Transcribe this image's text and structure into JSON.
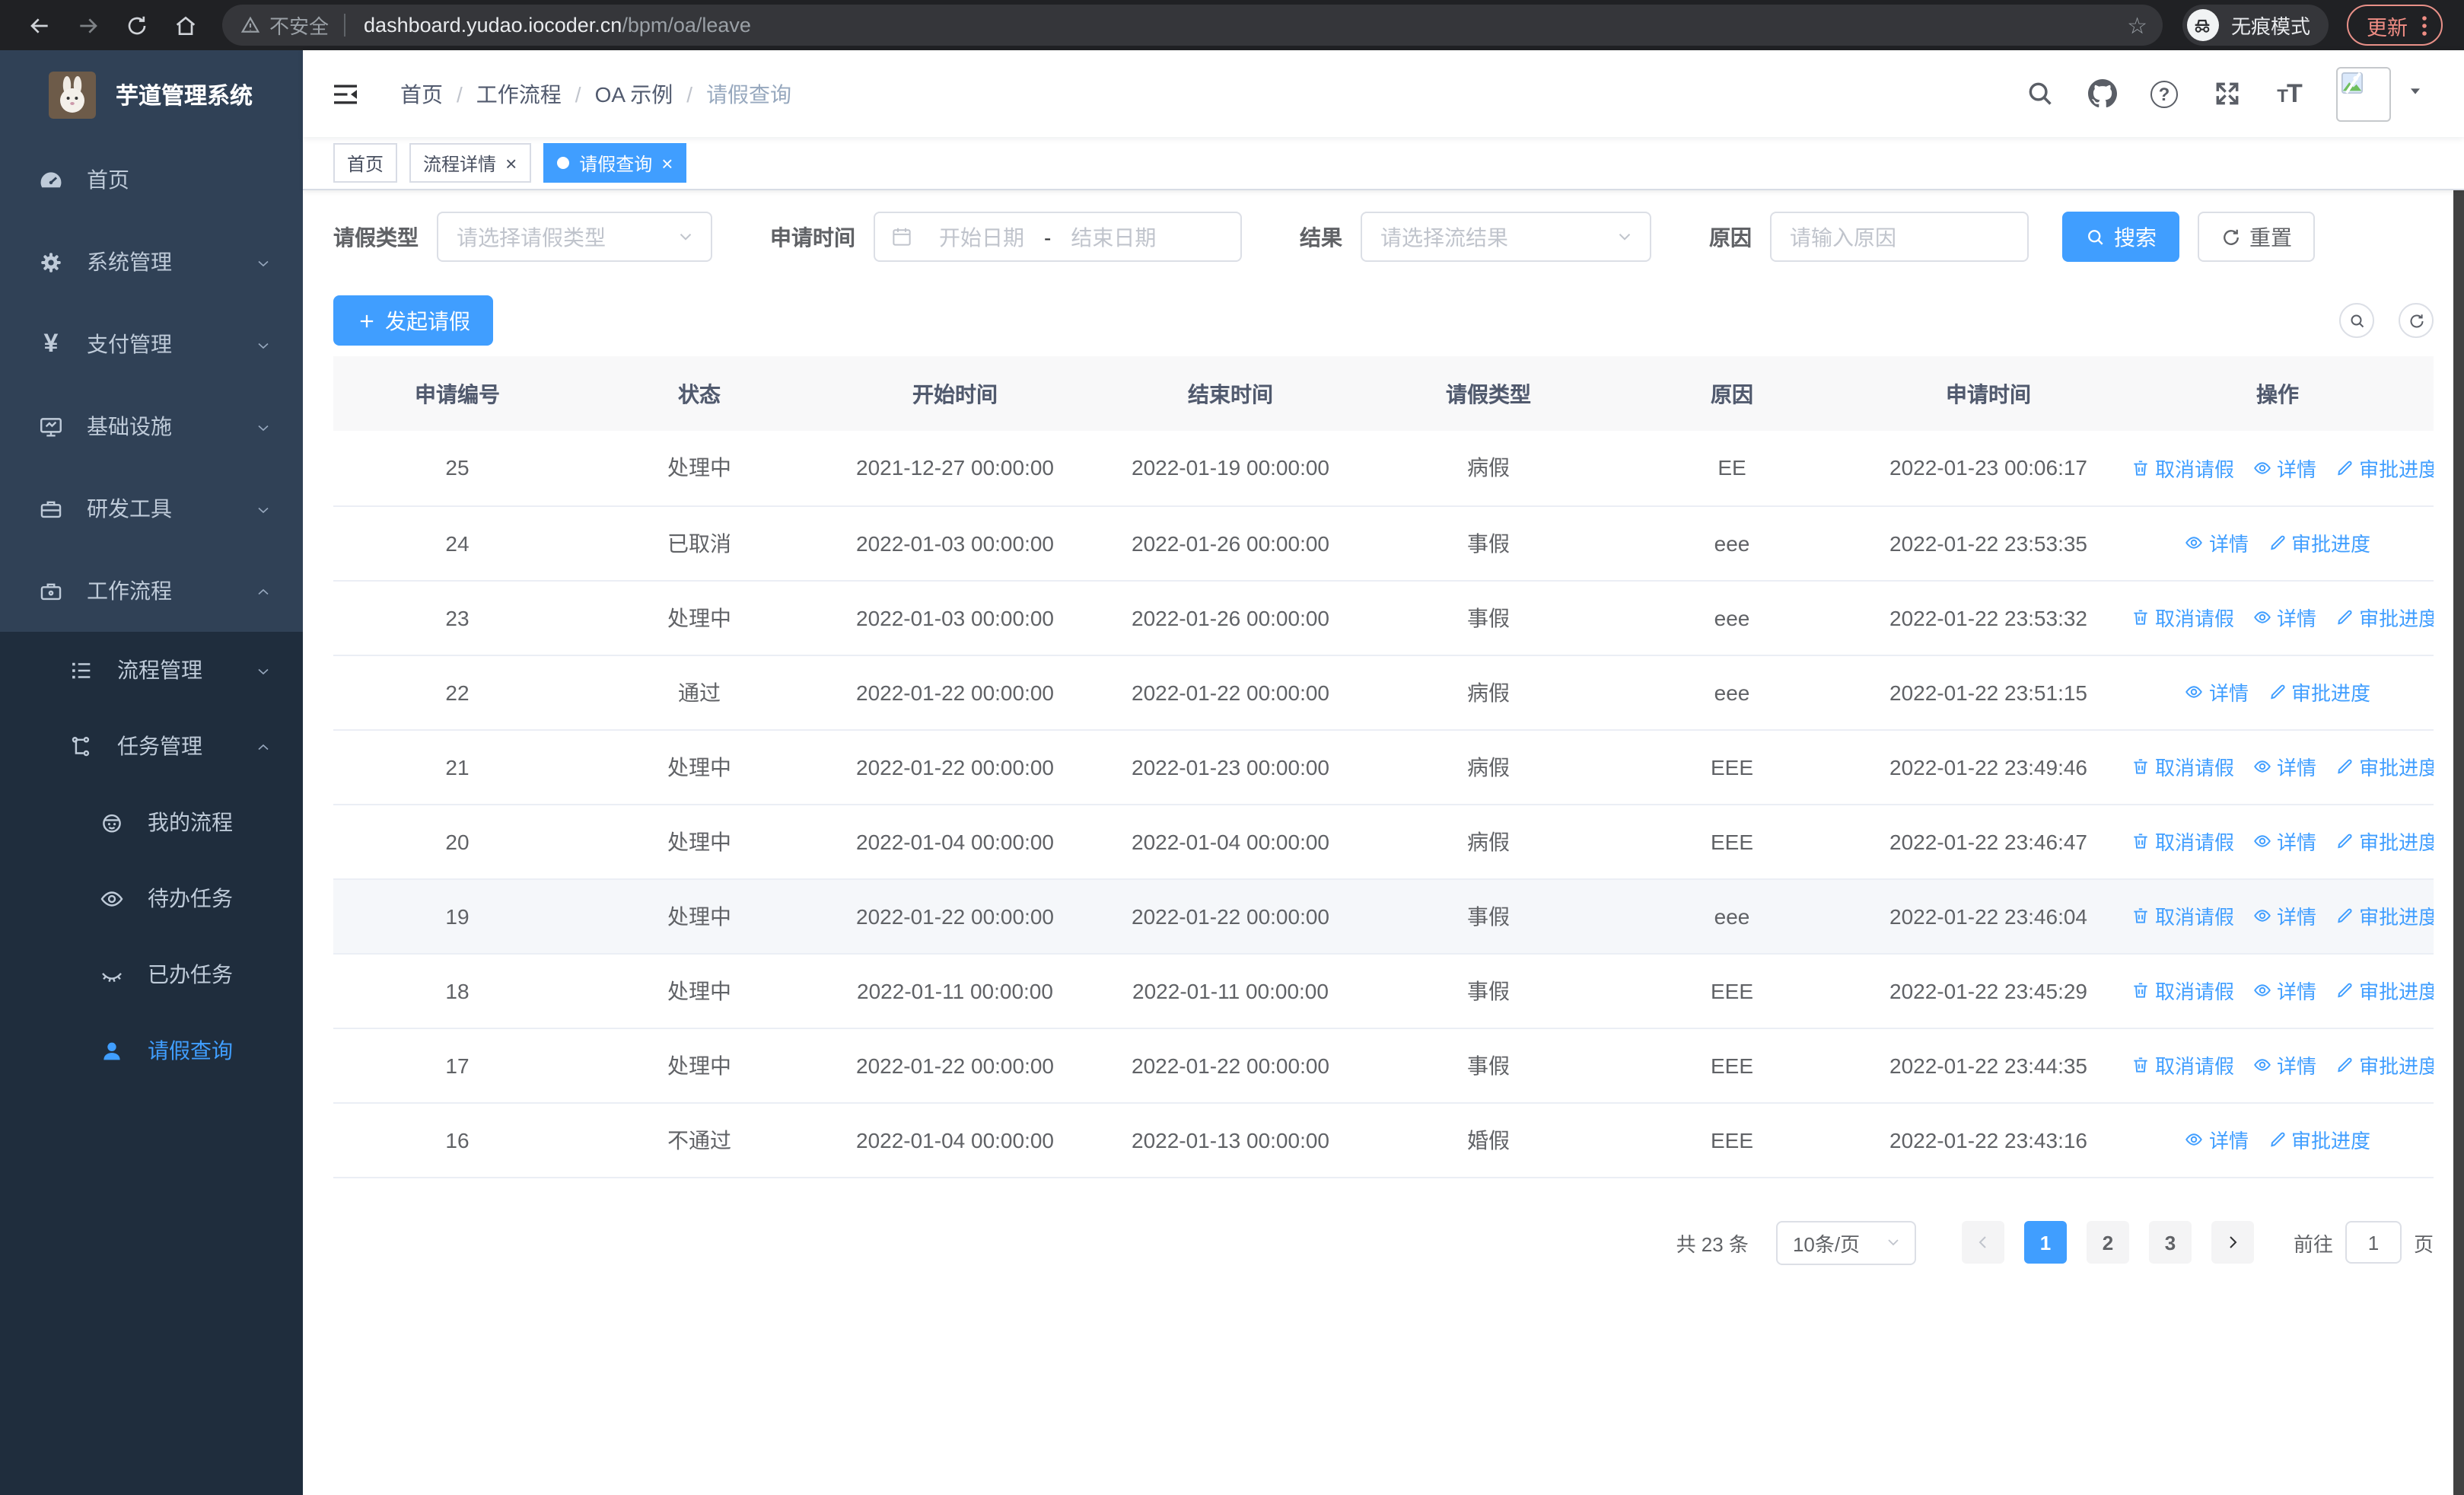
{
  "colors": {
    "primary": "#409eff",
    "sidebar_bg": "#304156",
    "submenu_bg": "#1f2d3d"
  },
  "browser": {
    "security_label": "不安全",
    "url_domain": "dashboard.yudao.iocoder.cn",
    "url_path": "/bpm/oa/leave",
    "incognito_label": "无痕模式",
    "update_label": "更新"
  },
  "sidebar": {
    "logo_title": "芋道管理系统",
    "items": [
      {
        "label": "首页"
      },
      {
        "label": "系统管理"
      },
      {
        "label": "支付管理"
      },
      {
        "label": "基础设施"
      },
      {
        "label": "研发工具"
      },
      {
        "label": "工作流程"
      }
    ],
    "sub_items": [
      {
        "label": "流程管理"
      },
      {
        "label": "任务管理"
      }
    ],
    "task_children": [
      {
        "label": "我的流程"
      },
      {
        "label": "待办任务"
      },
      {
        "label": "已办任务"
      },
      {
        "label": "请假查询"
      }
    ]
  },
  "header": {
    "breadcrumb": [
      "首页",
      "工作流程",
      "OA 示例",
      "请假查询"
    ]
  },
  "tabs": [
    {
      "label": "首页"
    },
    {
      "label": "流程详情"
    },
    {
      "label": "请假查询"
    }
  ],
  "filters": {
    "leave_type": {
      "label": "请假类型",
      "placeholder": "请选择请假类型"
    },
    "apply_time": {
      "label": "申请时间",
      "start_placeholder": "开始日期",
      "separator": "-",
      "end_placeholder": "结束日期"
    },
    "result": {
      "label": "结果",
      "placeholder": "请选择流结果"
    },
    "reason": {
      "label": "原因",
      "placeholder": "请输入原因"
    },
    "search_label": "搜索",
    "reset_label": "重置"
  },
  "toolbar": {
    "create_label": "发起请假"
  },
  "table": {
    "columns": [
      "申请编号",
      "状态",
      "开始时间",
      "结束时间",
      "请假类型",
      "原因",
      "申请时间",
      "操作"
    ],
    "highlighted_row_index": 6,
    "rows": [
      {
        "id": "25",
        "status": "处理中",
        "start_time": "2021-12-27 00:00:00",
        "end_time": "2022-01-19 00:00:00",
        "leave_type": "病假",
        "reason": "EE",
        "apply_time": "2022-01-23 00:06:17",
        "actions": [
          "取消请假",
          "详情",
          "审批进度"
        ]
      },
      {
        "id": "24",
        "status": "已取消",
        "start_time": "2022-01-03 00:00:00",
        "end_time": "2022-01-26 00:00:00",
        "leave_type": "事假",
        "reason": "eee",
        "apply_time": "2022-01-22 23:53:35",
        "actions": [
          "详情",
          "审批进度"
        ]
      },
      {
        "id": "23",
        "status": "处理中",
        "start_time": "2022-01-03 00:00:00",
        "end_time": "2022-01-26 00:00:00",
        "leave_type": "事假",
        "reason": "eee",
        "apply_time": "2022-01-22 23:53:32",
        "actions": [
          "取消请假",
          "详情",
          "审批进度"
        ]
      },
      {
        "id": "22",
        "status": "通过",
        "start_time": "2022-01-22 00:00:00",
        "end_time": "2022-01-22 00:00:00",
        "leave_type": "病假",
        "reason": "eee",
        "apply_time": "2022-01-22 23:51:15",
        "actions": [
          "详情",
          "审批进度"
        ]
      },
      {
        "id": "21",
        "status": "处理中",
        "start_time": "2022-01-22 00:00:00",
        "end_time": "2022-01-23 00:00:00",
        "leave_type": "病假",
        "reason": "EEE",
        "apply_time": "2022-01-22 23:49:46",
        "actions": [
          "取消请假",
          "详情",
          "审批进度"
        ]
      },
      {
        "id": "20",
        "status": "处理中",
        "start_time": "2022-01-04 00:00:00",
        "end_time": "2022-01-04 00:00:00",
        "leave_type": "病假",
        "reason": "EEE",
        "apply_time": "2022-01-22 23:46:47",
        "actions": [
          "取消请假",
          "详情",
          "审批进度"
        ]
      },
      {
        "id": "19",
        "status": "处理中",
        "start_time": "2022-01-22 00:00:00",
        "end_time": "2022-01-22 00:00:00",
        "leave_type": "事假",
        "reason": "eee",
        "apply_time": "2022-01-22 23:46:04",
        "actions": [
          "取消请假",
          "详情",
          "审批进度"
        ]
      },
      {
        "id": "18",
        "status": "处理中",
        "start_time": "2022-01-11 00:00:00",
        "end_time": "2022-01-11 00:00:00",
        "leave_type": "事假",
        "reason": "EEE",
        "apply_time": "2022-01-22 23:45:29",
        "actions": [
          "取消请假",
          "详情",
          "审批进度"
        ]
      },
      {
        "id": "17",
        "status": "处理中",
        "start_time": "2022-01-22 00:00:00",
        "end_time": "2022-01-22 00:00:00",
        "leave_type": "事假",
        "reason": "EEE",
        "apply_time": "2022-01-22 23:44:35",
        "actions": [
          "取消请假",
          "详情",
          "审批进度"
        ]
      },
      {
        "id": "16",
        "status": "不通过",
        "start_time": "2022-01-04 00:00:00",
        "end_time": "2022-01-13 00:00:00",
        "leave_type": "婚假",
        "reason": "EEE",
        "apply_time": "2022-01-22 23:43:16",
        "actions": [
          "详情",
          "审批进度"
        ]
      }
    ]
  },
  "pagination": {
    "total": "共 23 条",
    "page_size": "10条/页",
    "pages": [
      "1",
      "2",
      "3"
    ],
    "active_index": 0,
    "goto_label": "前往",
    "goto_value": "1",
    "unit": "页"
  }
}
